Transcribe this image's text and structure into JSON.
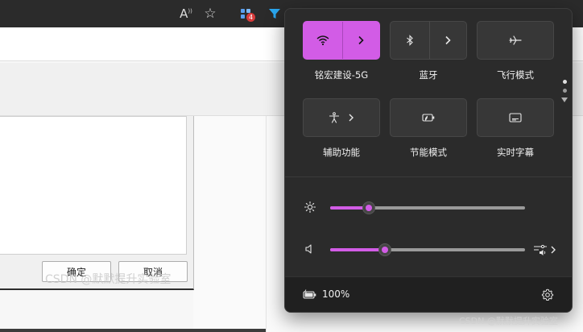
{
  "browser": {
    "read_aloud_glyph": "A",
    "read_aloud_sup": "))",
    "favorite_glyph": "☆",
    "extensions_badge": "4"
  },
  "dialog": {
    "ok_label": "确定",
    "cancel_label": "取消"
  },
  "quick_settings": {
    "tiles": [
      {
        "label": "铭宏建设-5G",
        "active": true
      },
      {
        "label": "蓝牙",
        "active": false
      },
      {
        "label": "飞行模式",
        "active": false
      },
      {
        "label": "辅助功能",
        "active": false
      },
      {
        "label": "节能模式",
        "active": false
      },
      {
        "label": "实时字幕",
        "active": false
      }
    ],
    "brightness_level": 0.2,
    "volume_level": 0.28,
    "battery_text": "100%"
  },
  "watermarks": {
    "dialog": "CSDN @默默提升实验室",
    "corner": "CSDN @默默提升实验室"
  },
  "colors": {
    "accent": "#d25ce6",
    "flyout_bg": "#2b2b2b",
    "browser_bar": "#2b2b2b"
  }
}
